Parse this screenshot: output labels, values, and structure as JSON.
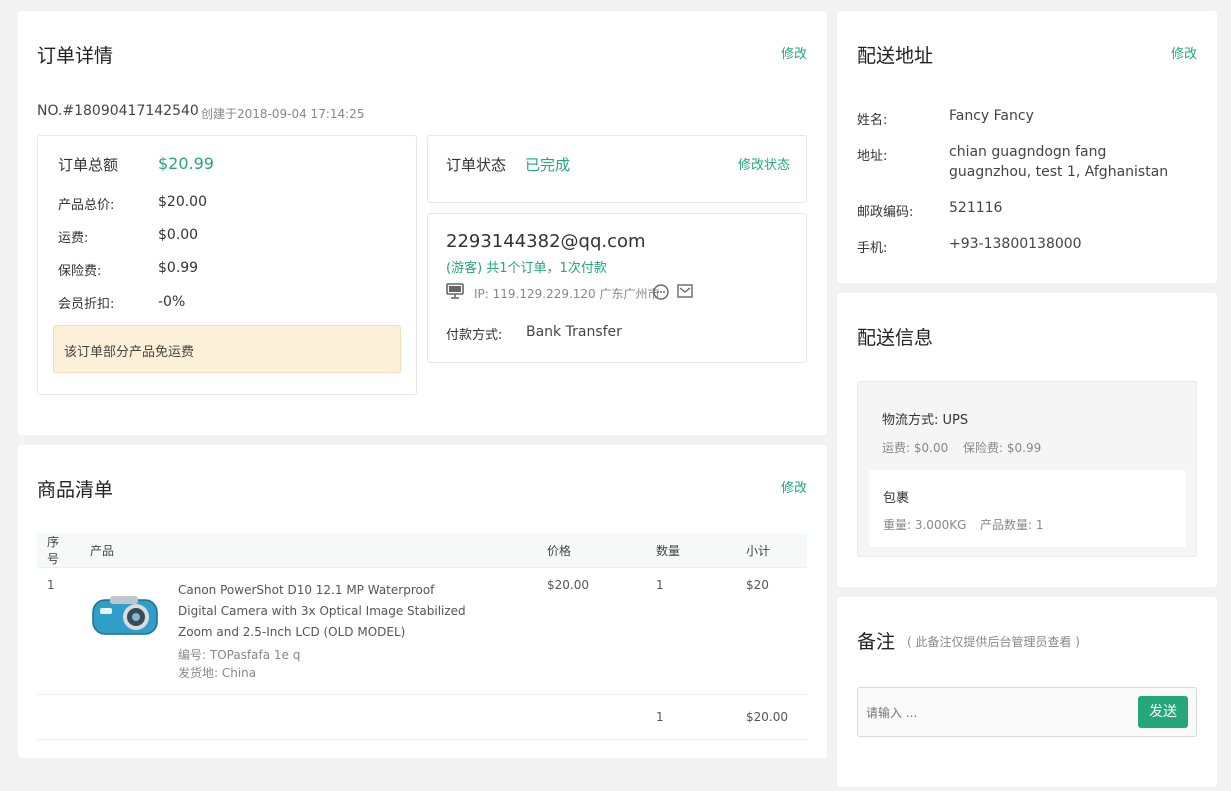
{
  "order": {
    "title": "订单详情",
    "edit": "修改",
    "order_no": "NO.#18090417142540",
    "created": "创建于2018-09-04 17:14:25",
    "total_label": "订单总额",
    "total_value": "$20.99",
    "rows": [
      {
        "label": "产品总价:",
        "value": "$20.00"
      },
      {
        "label": "运费:",
        "value": "$0.00"
      },
      {
        "label": "保险费:",
        "value": "$0.99"
      },
      {
        "label": "会员折扣:",
        "value": "-0%"
      }
    ],
    "notice": "该订单部分产品免运费",
    "status_label": "订单状态",
    "status_value": "已完成",
    "status_edit": "修改状态",
    "email": "2293144382@qq.com",
    "customer_info": "(游客) 共1个订单，1次付款",
    "ip": "IP: 119.129.229.120 广东广州市",
    "payment_label": "付款方式:",
    "payment_value": "Bank Transfer"
  },
  "goods": {
    "title": "商品清单",
    "edit": "修改",
    "headers": {
      "index": "序号",
      "product": "产品",
      "price": "价格",
      "qty": "数量",
      "subtotal": "小计"
    },
    "item": {
      "index": "1",
      "name_line1": "Canon PowerShot D10 12.1 MP Waterproof",
      "name_line2": "Digital Camera with 3x Optical Image Stabilized",
      "name_line3": "Zoom and 2.5-Inch LCD (OLD MODEL)",
      "sku": "编号: TOPasfafa 1e q",
      "origin": "发货地: China",
      "price": "$20.00",
      "qty": "1",
      "subtotal": "$20"
    },
    "summary": {
      "qty": "1",
      "total": "$20.00"
    }
  },
  "address": {
    "title": "配送地址",
    "edit": "修改",
    "name_label": "姓名:",
    "name_value": "Fancy Fancy",
    "addr_label": "地址:",
    "addr_line1": "chian guagndogn fang",
    "addr_line2": "guagnzhou, test 1, Afghanistan",
    "zip_label": "邮政编码:",
    "zip_value": "521116",
    "phone_label": "手机:",
    "phone_value": "+93-13800138000"
  },
  "shipping": {
    "title": "配送信息",
    "method": "物流方式: UPS",
    "freight": "运费: $0.00",
    "insurance": "保险费: $0.99",
    "package_title": "包裹",
    "weight": "重量: 3.000KG",
    "count": "产品数量: 1"
  },
  "note": {
    "title": "备注",
    "hint": "( 此备注仅提供后台管理员查看 )",
    "placeholder": "请输入 ...",
    "send": "发送"
  },
  "colors": {
    "accent": "#25a77a",
    "notice_bg": "#fdf0d9"
  }
}
